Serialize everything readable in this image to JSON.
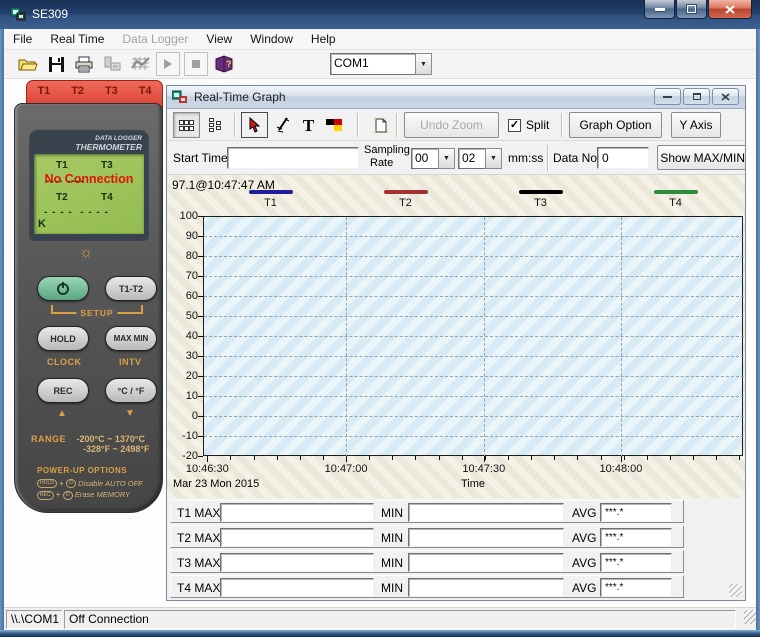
{
  "app": {
    "title": "SE309"
  },
  "menu": {
    "items": [
      {
        "label": "File",
        "enabled": true
      },
      {
        "label": "Real Time",
        "enabled": true
      },
      {
        "label": "Data Logger",
        "enabled": false
      },
      {
        "label": "View",
        "enabled": true
      },
      {
        "label": "Window",
        "enabled": true
      },
      {
        "label": "Help",
        "enabled": true
      }
    ]
  },
  "toolbar": {
    "com_port": "COM1",
    "icons": [
      "open-file",
      "save",
      "print",
      "transfer-data",
      "logger-graph",
      "start",
      "stop",
      "help"
    ]
  },
  "device": {
    "jacks": [
      "T1",
      "T2",
      "T3",
      "T4"
    ],
    "lcd": {
      "brand1": "DATA LOGGER",
      "brand2": "THERMOMETER",
      "ch1": "T1",
      "ch3": "T3",
      "status": "No Connection",
      "ch2": "T2",
      "ch4": "T4",
      "dashes1": "---- ----",
      "dashes2": "- - - -  - - - -",
      "unit": "K"
    },
    "buttons": {
      "setup": "SETUP",
      "t1t2": "T1-T2",
      "hold": "HOLD",
      "maxmin": "MAX MIN",
      "clock": "CLOCK",
      "intv": "INTV",
      "rec": "REC",
      "cf": "°C / °F"
    },
    "range": {
      "label": "RANGE",
      "celsius": "-200°C ~ 1370°C",
      "fahrenheit": "-328°F ~ 2498°F"
    },
    "powerup": {
      "title": "POWER-UP OPTIONS",
      "opt1_key1": "HOLD",
      "opt1_key2": "O",
      "plus": "+",
      "opt1_text": "Disable AUTO OFF",
      "opt2_key1": "REC",
      "opt2_key2": "O",
      "opt2_text": "Erase MEMORY"
    }
  },
  "graph_window": {
    "title": "Real-Time Graph",
    "toolbar": {
      "undo_zoom": "Undo Zoom",
      "split_label": "Split",
      "split_checked": true,
      "graph_option": "Graph Option",
      "y_axis": "Y Axis",
      "icons": [
        "tile-horizontal",
        "tile-vertical",
        "pointer",
        "zoom-cursor",
        "text-tool",
        "color-tool",
        "new-document"
      ]
    },
    "controls": {
      "start_time_label": "Start Time",
      "start_time_value": "",
      "sampling_label_1": "Sampling",
      "sampling_label_2": "Rate",
      "sampling_minutes": "00",
      "sampling_seconds": "02",
      "sampling_units": "mm:ss",
      "data_no_label": "Data No.",
      "data_no_value": "0",
      "show_maxmin_button": "Show MAX/MIN on"
    },
    "chart": {
      "type": "line",
      "annotation": "97.1@10:47:47 AM",
      "series": [
        {
          "name": "T1",
          "color": "#1f1f99",
          "values": []
        },
        {
          "name": "T2",
          "color": "#a03232",
          "values": []
        },
        {
          "name": "T3",
          "color": "#000000",
          "values": []
        },
        {
          "name": "T4",
          "color": "#2f8b3c",
          "values": []
        }
      ],
      "ylim": [
        -20,
        100
      ],
      "y_ticks": [
        100,
        90,
        80,
        70,
        60,
        50,
        40,
        30,
        20,
        10,
        0,
        -10,
        -20
      ],
      "x_ticks": [
        {
          "label": "10:46:30",
          "pct": 0.8
        },
        {
          "label": "10:47:00",
          "pct": 26.5
        },
        {
          "label": "10:47:30",
          "pct": 52.0
        },
        {
          "label": "10:48:00",
          "pct": 77.4
        }
      ],
      "xlabel": "Time",
      "date_label": "Mar 23 Mon 2015",
      "grid": true,
      "legend_position": "top"
    },
    "stats": {
      "min_label": "MIN",
      "avg_label": "AVG",
      "rows": [
        {
          "label": "T1 MAX",
          "max": "",
          "min": "",
          "avg": "***.*"
        },
        {
          "label": "T2 MAX",
          "max": "",
          "min": "",
          "avg": "***.*"
        },
        {
          "label": "T3 MAX",
          "max": "",
          "min": "",
          "avg": "***.*"
        },
        {
          "label": "T4 MAX",
          "max": "",
          "min": "",
          "avg": "***.*"
        }
      ]
    }
  },
  "status_bar": {
    "port": "\\\\.\\COM1",
    "message": "Off Connection"
  }
}
